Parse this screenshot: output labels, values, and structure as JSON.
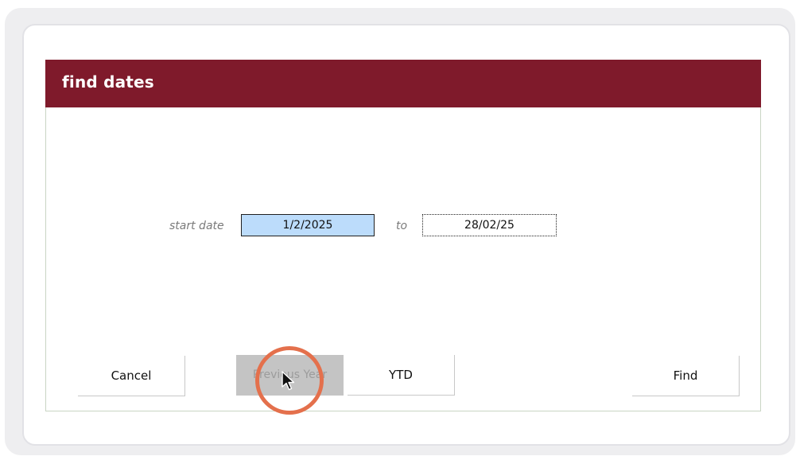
{
  "dialog": {
    "title": "find dates",
    "start_label": "start date",
    "start_value": "1/2/2025",
    "to_label": "to",
    "end_value": "28/02/25"
  },
  "buttons": {
    "cancel": "Cancel",
    "previous_year": "Previous Year",
    "ytd": "YTD",
    "find": "Find"
  },
  "colors": {
    "titlebar": "#7f1a2b",
    "start_field_bg": "#bcdcfb",
    "highlight_ring": "#e4704c"
  },
  "icons": {
    "cursor": "arrow-cursor-icon"
  }
}
